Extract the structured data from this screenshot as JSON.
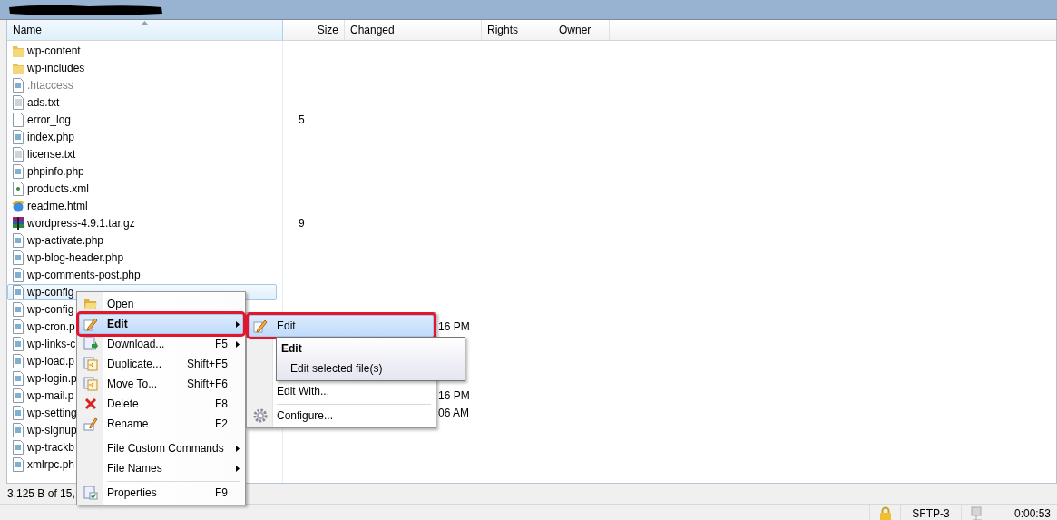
{
  "columns": [
    {
      "label": "Name",
      "sorted": true
    },
    {
      "label": "Size",
      "sorted": false
    },
    {
      "label": "Changed",
      "sorted": false
    },
    {
      "label": "Rights",
      "sorted": false
    },
    {
      "label": "Owner",
      "sorted": false
    }
  ],
  "files": [
    {
      "name": "wp-content",
      "kind": "folder",
      "dim": false,
      "selected": false
    },
    {
      "name": "wp-includes",
      "kind": "folder",
      "dim": false,
      "selected": false
    },
    {
      "name": ".htaccess",
      "kind": "php",
      "dim": true,
      "selected": false
    },
    {
      "name": "ads.txt",
      "kind": "text",
      "dim": false,
      "selected": false
    },
    {
      "name": "error_log",
      "kind": "blank",
      "dim": false,
      "selected": false,
      "size": "5"
    },
    {
      "name": "index.php",
      "kind": "php",
      "dim": false,
      "selected": false
    },
    {
      "name": "license.txt",
      "kind": "text",
      "dim": false,
      "selected": false
    },
    {
      "name": "phpinfo.php",
      "kind": "php",
      "dim": false,
      "selected": false
    },
    {
      "name": "products.xml",
      "kind": "xml",
      "dim": false,
      "selected": false
    },
    {
      "name": "readme.html",
      "kind": "html",
      "dim": false,
      "selected": false
    },
    {
      "name": "wordpress-4.9.1.tar.gz",
      "kind": "archive",
      "dim": false,
      "selected": false,
      "size": "9"
    },
    {
      "name": "wp-activate.php",
      "kind": "php",
      "dim": false,
      "selected": false
    },
    {
      "name": "wp-blog-header.php",
      "kind": "php",
      "dim": false,
      "selected": false
    },
    {
      "name": "wp-comments-post.php",
      "kind": "php",
      "dim": false,
      "selected": false
    },
    {
      "name": "wp-config",
      "kind": "php",
      "dim": false,
      "selected": true
    },
    {
      "name": "wp-config",
      "kind": "php",
      "dim": false,
      "selected": false
    },
    {
      "name": "wp-cron.p",
      "kind": "php",
      "dim": false,
      "selected": false,
      "changed": "16 PM"
    },
    {
      "name": "wp-links-c",
      "kind": "php",
      "dim": false,
      "selected": false
    },
    {
      "name": "wp-load.p",
      "kind": "php",
      "dim": false,
      "selected": false
    },
    {
      "name": "wp-login.p",
      "kind": "php",
      "dim": false,
      "selected": false
    },
    {
      "name": "wp-mail.p",
      "kind": "php",
      "dim": false,
      "selected": false,
      "changed": "16 PM"
    },
    {
      "name": "wp-setting",
      "kind": "php",
      "dim": false,
      "selected": false,
      "changed": "06 AM"
    },
    {
      "name": "wp-signup",
      "kind": "php",
      "dim": false,
      "selected": false
    },
    {
      "name": "wp-trackb",
      "kind": "php",
      "dim": false,
      "selected": false
    },
    {
      "name": "xmlrpc.ph",
      "kind": "php",
      "dim": false,
      "selected": false
    }
  ],
  "context_menu": {
    "items": [
      {
        "label": "Open",
        "kind": "open",
        "highlighted": false,
        "framed": false,
        "submenu": false,
        "separator_before": false
      },
      {
        "label": "Edit",
        "kind": "edit",
        "highlighted": true,
        "framed": true,
        "submenu": true,
        "separator_before": false
      },
      {
        "label": "Download...",
        "shortcut": "F5",
        "kind": "download",
        "highlighted": false,
        "framed": false,
        "submenu": true,
        "separator_before": false
      },
      {
        "label": "Duplicate...",
        "shortcut": "Shift+F5",
        "kind": "duplicate",
        "highlighted": false,
        "framed": false,
        "submenu": false,
        "separator_before": false
      },
      {
        "label": "Move To...",
        "shortcut": "Shift+F6",
        "kind": "move",
        "highlighted": false,
        "framed": false,
        "submenu": false,
        "separator_before": false
      },
      {
        "label": "Delete",
        "shortcut": "F8",
        "kind": "delete",
        "highlighted": false,
        "framed": false,
        "submenu": false,
        "separator_before": false
      },
      {
        "label": "Rename",
        "shortcut": "F2",
        "kind": "rename",
        "highlighted": false,
        "framed": false,
        "submenu": false,
        "separator_before": false
      },
      {
        "label": "File Custom Commands",
        "kind": "plain",
        "highlighted": false,
        "framed": false,
        "submenu": true,
        "separator_before": true
      },
      {
        "label": "File Names",
        "kind": "plain",
        "highlighted": false,
        "framed": false,
        "submenu": true,
        "separator_before": false
      },
      {
        "label": "Properties",
        "shortcut": "F9",
        "kind": "properties",
        "highlighted": false,
        "framed": false,
        "submenu": false,
        "separator_before": true
      }
    ]
  },
  "submenu": {
    "items": [
      {
        "label": "Edit",
        "kind": "edit",
        "highlighted": true,
        "framed": true,
        "separator_before": false
      },
      {
        "label": "Edit With...",
        "kind": "plain",
        "highlighted": false,
        "framed": false,
        "separator_before": false
      },
      {
        "label": "Configure...",
        "kind": "gear",
        "highlighted": false,
        "framed": false,
        "separator_before": true
      }
    ]
  },
  "tooltip": {
    "title": "Edit",
    "text": "Edit selected file(s)"
  },
  "status_bar": {
    "selection": "3,125 B of 15,",
    "protocol": "SFTP-3",
    "elapsed": "0:00:53"
  }
}
